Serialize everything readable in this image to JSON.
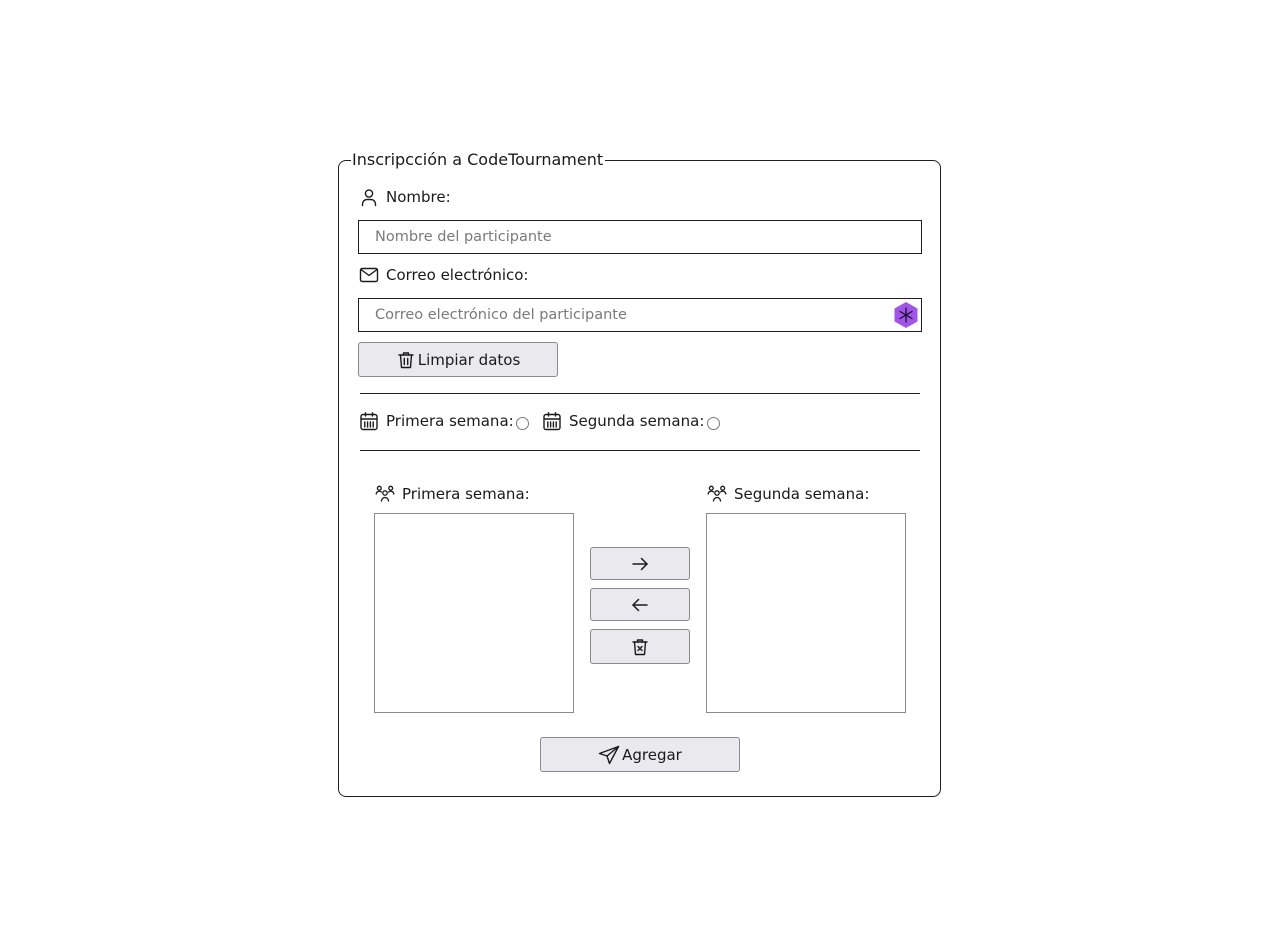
{
  "form": {
    "legend": "Inscripcción a CodeTournament",
    "name_label": "Nombre:",
    "name_placeholder": "Nombre del participante",
    "email_label": "Correo electrónico:",
    "email_placeholder": "Correo electrónico del participante",
    "clear_button": "Limpiar datos",
    "submit_button": "Agregar"
  },
  "weeks": {
    "first_radio_label": "Primera semana:",
    "second_radio_label": "Segunda semana:",
    "first_radio_checked": false,
    "second_radio_checked": false
  },
  "lists": {
    "first_label": "Primera semana:",
    "second_label": "Segunda semana:",
    "first_items": [],
    "second_items": []
  },
  "transfer_buttons": [
    {
      "icon": "arrow-right-icon",
      "glyph": "→"
    },
    {
      "icon": "arrow-left-icon",
      "glyph": "←"
    },
    {
      "icon": "trash-x-icon",
      "glyph": "🗑"
    }
  ],
  "colors": {
    "border": "#1f1f1f",
    "button_bg": "#e9e9ee",
    "button_border": "#8a8a8e",
    "badge_purple": "#a155e6"
  },
  "icons": {
    "name": "user-icon",
    "email": "mail-icon",
    "calendar": "calendar-icon",
    "users": "users-icon",
    "clear": "trash-icon",
    "submit": "send-icon",
    "extension": "extension-badge-icon"
  }
}
